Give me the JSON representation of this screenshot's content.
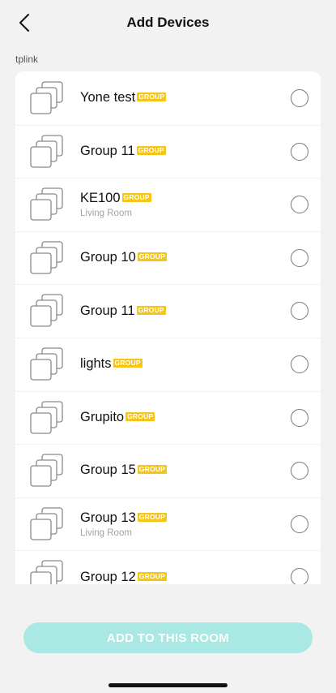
{
  "header": {
    "title": "Add Devices",
    "back_icon": "chevron-left-icon"
  },
  "section": {
    "label": "tplink"
  },
  "badge_text": "GROUP",
  "devices": [
    {
      "name": "Yone test",
      "sub": "",
      "selected": false
    },
    {
      "name": "Group 11",
      "sub": "",
      "selected": false
    },
    {
      "name": "KE100",
      "sub": "Living Room",
      "selected": false
    },
    {
      "name": "Group 10",
      "sub": "",
      "selected": false
    },
    {
      "name": "Group 11",
      "sub": "",
      "selected": false
    },
    {
      "name": "lights",
      "sub": "",
      "selected": false
    },
    {
      "name": "Grupito",
      "sub": "",
      "selected": false
    },
    {
      "name": "Group 15",
      "sub": "",
      "selected": false
    },
    {
      "name": "Group 13",
      "sub": "Living Room",
      "selected": false
    },
    {
      "name": "Group 12",
      "sub": "",
      "selected": false
    }
  ],
  "footer": {
    "add_button_label": "ADD TO THIS ROOM"
  },
  "colors": {
    "accent_disabled": "#a9e8e3",
    "badge": "#f5c518",
    "background": "#f2f2f2"
  }
}
